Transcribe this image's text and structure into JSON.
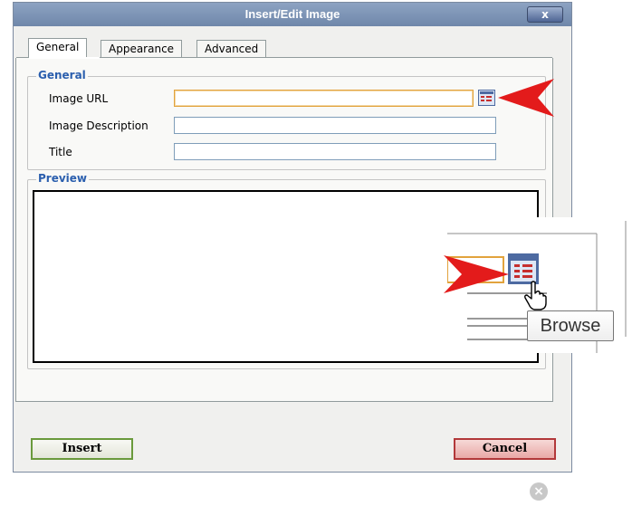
{
  "dialog": {
    "title": "Insert/Edit Image",
    "close_glyph": "x"
  },
  "tabs": [
    {
      "label": "General",
      "active": true
    },
    {
      "label": "Appearance",
      "active": false
    },
    {
      "label": "Advanced",
      "active": false
    }
  ],
  "general": {
    "legend": "General",
    "fields": [
      {
        "label": "Image URL",
        "value": "",
        "focused": true
      },
      {
        "label": "Image Description",
        "value": ""
      },
      {
        "label": "Title",
        "value": ""
      }
    ]
  },
  "preview": {
    "legend": "Preview"
  },
  "buttons": {
    "insert": "Insert",
    "cancel": "Cancel"
  },
  "callout": {
    "tooltip": "Browse",
    "arrow_color": "#e31b1b"
  },
  "icons": {
    "browse": "browse-icon",
    "close": "close-icon",
    "dismiss": "dismiss-icon",
    "cursor": "hand-cursor-icon"
  },
  "colors": {
    "titlebar": "#7a90b4",
    "legend_text": "#2b5fae",
    "focus_border": "#e2a33d",
    "insert_border": "#6a9a3c",
    "cancel_border": "#b2383a"
  }
}
